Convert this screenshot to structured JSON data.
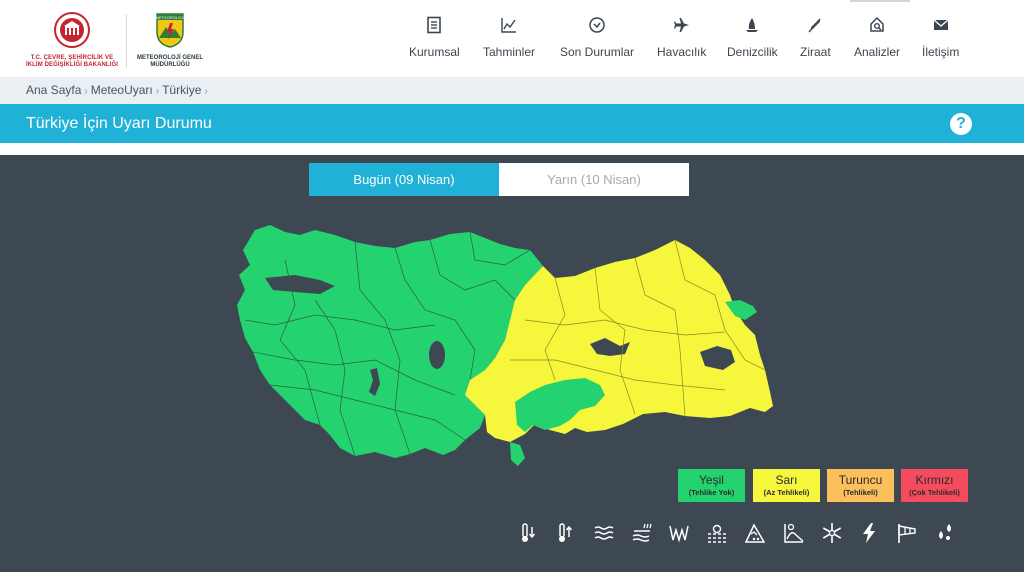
{
  "header": {
    "ministry_logo_text": "T.C. ÇEVRE, ŞEHİRCİLİK VE İKLİM DEĞİŞİKLİĞİ BAKANLIĞI",
    "mgm_logo_text": "METEOROLOJİ GENEL MÜDÜRLÜĞÜ",
    "mgm_badge_text": "METEOROLOJI"
  },
  "nav": [
    {
      "label": "Kurumsal",
      "icon": "document-icon"
    },
    {
      "label": "Tahminler",
      "icon": "chart-icon"
    },
    {
      "label": "Son Durumlar",
      "icon": "check-circle-icon"
    },
    {
      "label": "Havacılık",
      "icon": "airplane-icon"
    },
    {
      "label": "Denizcilik",
      "icon": "sailboat-icon"
    },
    {
      "label": "Ziraat",
      "icon": "wheat-icon"
    },
    {
      "label": "Analizler",
      "icon": "analysis-icon"
    },
    {
      "label": "İletişim",
      "icon": "envelope-icon"
    }
  ],
  "breadcrumb": {
    "items": [
      "Ana Sayfa",
      "MeteoUyarı",
      "Türkiye"
    ],
    "separator": "›"
  },
  "page_title": "Türkiye İçin Uyarı Durumu",
  "help_symbol": "?",
  "tabs": {
    "today": "Bugün (09 Nisan)",
    "tomorrow": "Yarın (10 Nisan)"
  },
  "legend": [
    {
      "name": "Yeşil",
      "desc": "(Tehlike Yok)",
      "color": "#24d370"
    },
    {
      "name": "Sarı",
      "desc": "(Az Tehlikeli)",
      "color": "#f6f63d"
    },
    {
      "name": "Turuncu",
      "desc": "(Tehlikeli)",
      "color": "#fbbf5c"
    },
    {
      "name": "Kırmızı",
      "desc": "(Çok Tehlikeli)",
      "color": "#f54b5f"
    }
  ],
  "map_colors": {
    "green": "#24d370",
    "yellow": "#f6f63d",
    "water": "#3d4853",
    "border": "#2b5f3e"
  },
  "hazard_icons": [
    "cold-icon",
    "heat-icon",
    "wind-icon",
    "rain-icon",
    "storm-icon",
    "fog-icon",
    "avalanche-icon",
    "dust-icon",
    "snow-icon",
    "lightning-icon",
    "windsock-icon",
    "hail-icon"
  ]
}
